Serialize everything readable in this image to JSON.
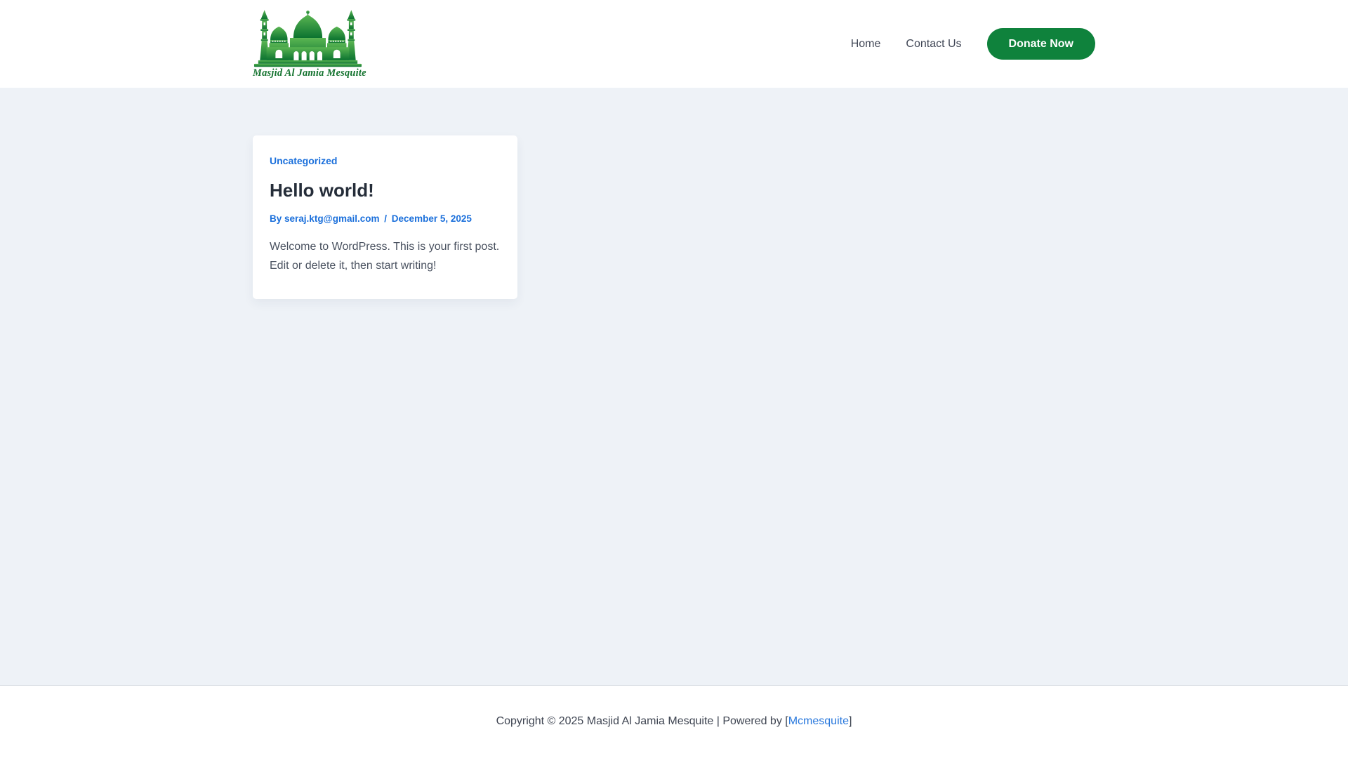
{
  "header": {
    "site_title": "Masjid Al Jamia Mesquite",
    "nav": [
      {
        "label": "Home"
      },
      {
        "label": "Contact Us"
      }
    ],
    "donate_button_label": "Donate Now"
  },
  "post_card": {
    "category": "Uncategorized",
    "title": "Hello world!",
    "meta": {
      "by_label": "By",
      "author": "seraj.ktg@gmail.com",
      "separator": "/",
      "date": "December 5, 2025"
    },
    "excerpt_line1": "Welcome to WordPress. This is your first post.",
    "excerpt_line2": "Edit or delete it, then start writing!"
  },
  "footer": {
    "copyright_prefix": "Copyright © 2025 Masjid Al Jamia Mesquite | Powered by [",
    "credit_link": "Mcmesquite",
    "copyright_suffix": "]"
  },
  "colors": {
    "accent_green": "#0f823c",
    "logo_green_light": "#5ab552",
    "logo_green_dark": "#0b7330",
    "link_blue": "#1a6fdb",
    "heading_dark": "#252d39",
    "body_text": "#4a5260",
    "page_background": "#eef2f7"
  }
}
